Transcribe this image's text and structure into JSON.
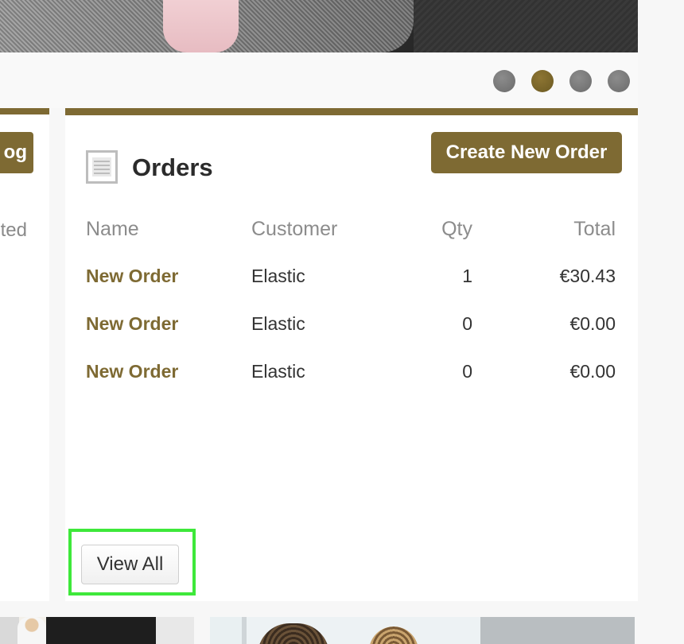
{
  "carousel": {
    "dots": [
      {
        "active": false
      },
      {
        "active": true
      },
      {
        "active": false
      },
      {
        "active": false
      }
    ],
    "active_color": "#7e6a33",
    "inactive_color": "#7a7a7a"
  },
  "left_panel": {
    "button_label_partial": "og",
    "column_header_partial": "ted"
  },
  "orders": {
    "title": "Orders",
    "create_label": "Create New Order",
    "columns": {
      "name": "Name",
      "customer": "Customer",
      "qty": "Qty",
      "total": "Total"
    },
    "rows": [
      {
        "name": "New Order",
        "customer": "Elastic",
        "qty": "1",
        "total": "€30.43"
      },
      {
        "name": "New Order",
        "customer": "Elastic",
        "qty": "0",
        "total": "€0.00"
      },
      {
        "name": "New Order",
        "customer": "Elastic",
        "qty": "0",
        "total": "€0.00"
      }
    ],
    "view_all_label": "View All",
    "icon": "document-icon"
  },
  "colors": {
    "accent": "#7e6a33",
    "highlight": "#3ee83a",
    "header_text": "#8c8c8c",
    "body_text": "#333333"
  }
}
